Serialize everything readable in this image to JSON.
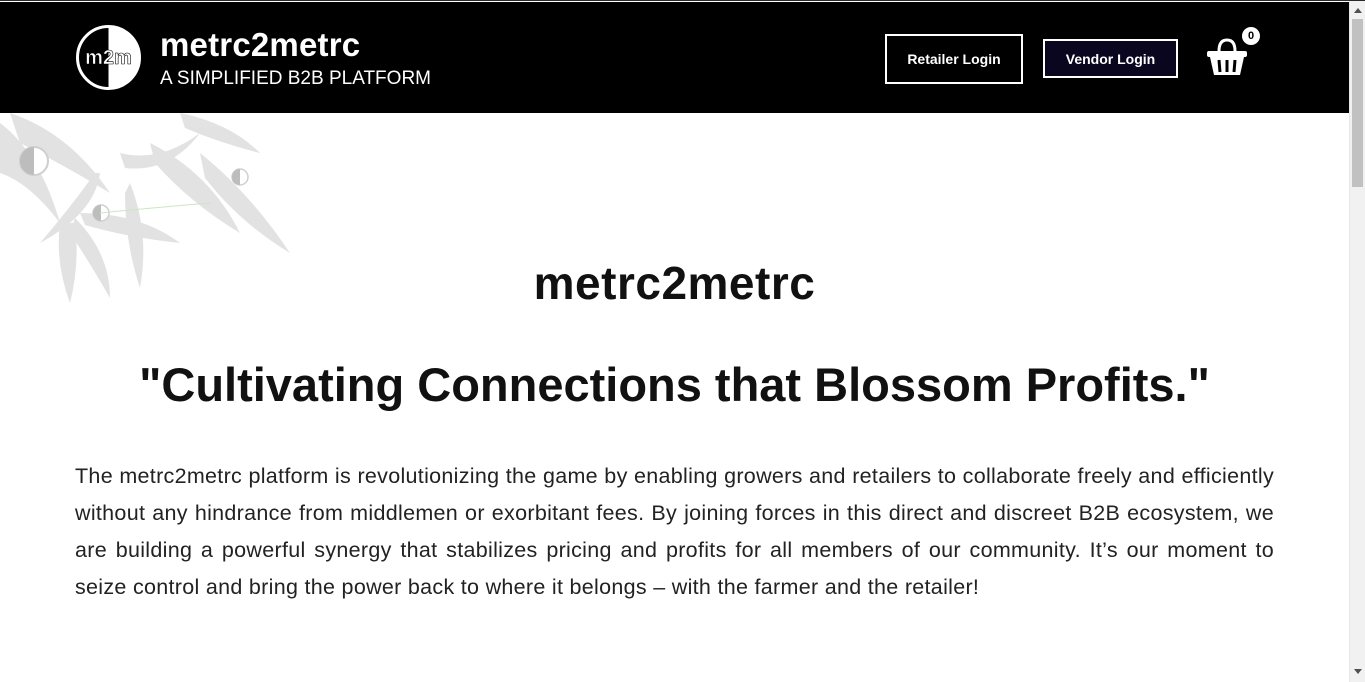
{
  "header": {
    "logo_text": "m2m",
    "brand_name": "metrc2metrc",
    "tagline": "A SIMPLIFIED B2B PLATFORM",
    "retailer_login_label": "Retailer Login",
    "vendor_login_label": "Vendor Login",
    "cart_icon": "shopping-basket-icon",
    "cart_count": "0"
  },
  "main": {
    "title": "metrc2metrc",
    "slogan": "\"Cultivating Connections that Blossom Profits.\"",
    "intro": "The metrc2metrc platform is revolutionizing the game by enabling growers and retailers to collaborate freely and efficiently without any hindrance from middlemen or exorbitant fees. By joining forces in this direct and discreet B2B ecosystem, we are building a powerful synergy that stabilizes pricing and profits for all members of our community. It’s our moment to seize control and bring the power back to where it belongs – with the farmer and the retailer!"
  },
  "colors": {
    "header_bg": "#000000",
    "vendor_btn_bg": "#0a0620",
    "text": "#111111"
  }
}
